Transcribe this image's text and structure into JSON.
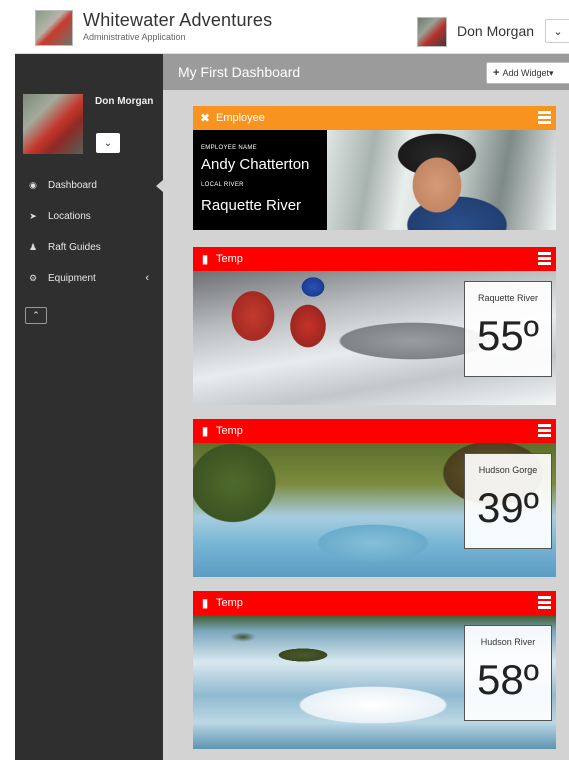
{
  "app": {
    "title": "Whitewater Adventures",
    "subtitle": "Administrative Application"
  },
  "header": {
    "user_name": "Don Morgan"
  },
  "sidebar": {
    "user_name": "Don Morgan",
    "items": [
      {
        "label": "Dashboard",
        "icon": "dashboard-icon",
        "active": true
      },
      {
        "label": "Locations",
        "icon": "location-arrow-icon"
      },
      {
        "label": "Raft Guides",
        "icon": "user-icon"
      },
      {
        "label": "Equipment",
        "icon": "cogs-icon",
        "expandable": true
      }
    ]
  },
  "main": {
    "page_title": "My First Dashboard",
    "add_widget_label": "Add Widget",
    "employee_widget": {
      "title": "Employee",
      "header_color": "#f7931e",
      "employee_name_label": "EMPLOYEE NAME",
      "employee_name": "Andy Chatterton",
      "local_river_label": "LOCAL RIVER",
      "local_river": "Raquette River"
    },
    "temp_widgets": [
      {
        "title": "Temp",
        "location": "Raquette River",
        "value": "55º",
        "header_color": "#ff0000"
      },
      {
        "title": "Temp",
        "location": "Hudson Gorge",
        "value": "39º",
        "header_color": "#ff0000"
      },
      {
        "title": "Temp",
        "location": "Hudson River",
        "value": "58º",
        "header_color": "#ff0000"
      }
    ]
  }
}
